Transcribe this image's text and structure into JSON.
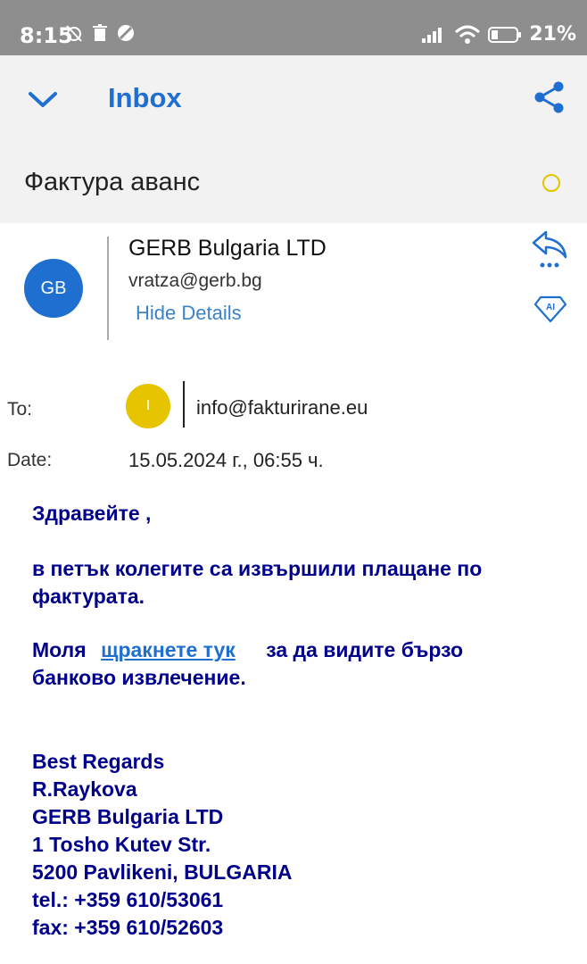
{
  "status_bar": {
    "time": "8:15",
    "battery": "21%"
  },
  "header": {
    "folder": "Inbox",
    "subject": "Фактура аванс"
  },
  "sender": {
    "initials": "GB",
    "name": "GERB Bulgaria LTD",
    "email": "vratza@gerb.bg",
    "hide_details": "Hide Details"
  },
  "recipients": {
    "to_label": "To:",
    "to_initial": "I",
    "to_email": "info@fakturirane.eu",
    "date_label": "Date:",
    "date_value": "15.05.2024 г., 06:55 ч."
  },
  "body": {
    "greeting": "Здравейте ,",
    "para1_line1": "в петък колегите са извършили плащане по",
    "para1_line2": "фактурата.",
    "para2_pre": "Моля",
    "para2_link": "щракнете тук",
    "para2_post": "за да видите бързо",
    "para2_line2": "банково извлечение.",
    "signature": [
      "Best Regards",
      "R.Raykova",
      "GERB Bulgaria LTD",
      "1 Tosho Kutev Str.",
      "5200 Pavlikeni, BULGARIA",
      "tel.: +359 610/53061",
      "fax: +359 610/52603"
    ]
  },
  "colors": {
    "accent": "#1f6fd1",
    "body_text": "#00008b",
    "unread": "#e2c400"
  }
}
